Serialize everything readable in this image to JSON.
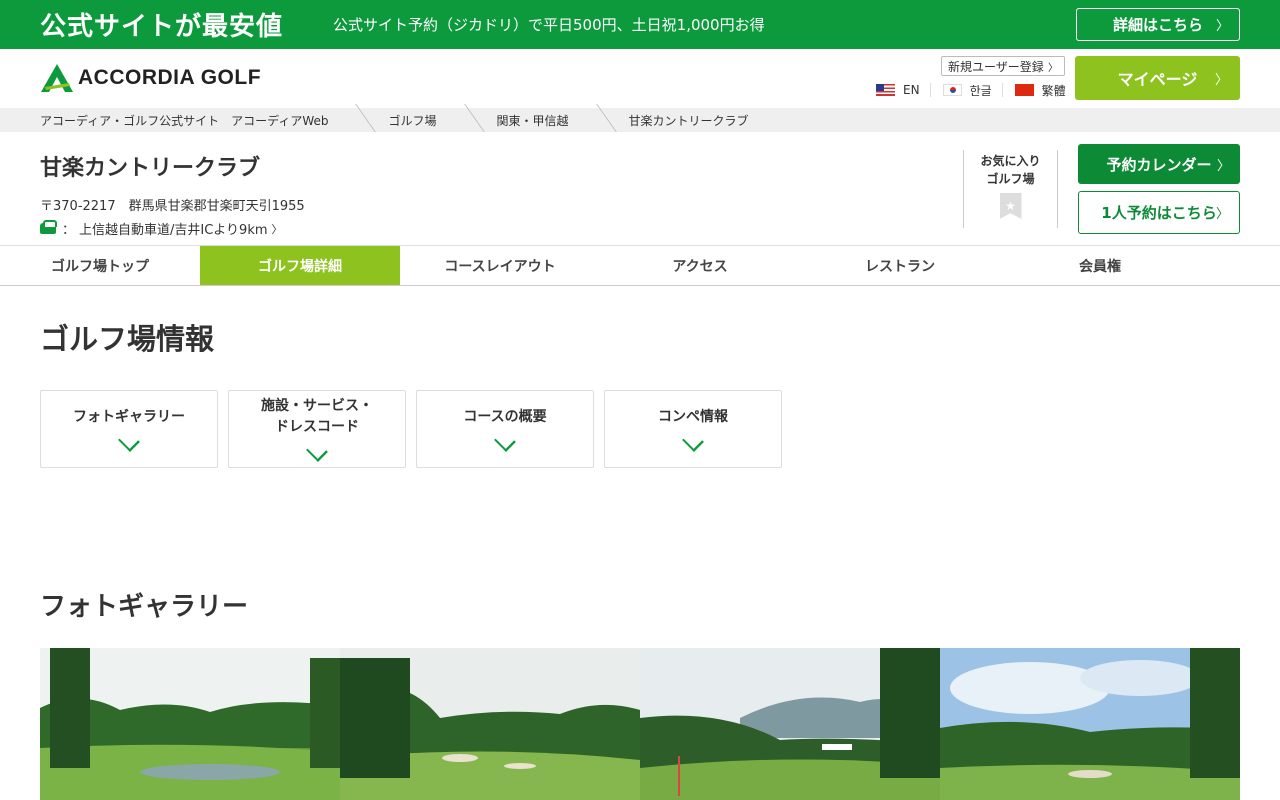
{
  "promo": {
    "headline": "公式サイトが最安値",
    "subtext": "公式サイト予約（ジカドリ）で平日500円、土日祝1,000円お得",
    "detail_button": "詳細はこちら"
  },
  "header": {
    "logo_text": "ACCORDIA GOLF",
    "register_link": "新規ユーザー登録",
    "languages": [
      {
        "label": "EN",
        "flag": "us-flag-icon"
      },
      {
        "label": "한글",
        "flag": "kr-flag-icon"
      },
      {
        "label": "繁體",
        "flag": "cn-flag-icon"
      }
    ],
    "mypage_button": "マイページ"
  },
  "breadcrumb": [
    "アコーディア・ゴルフ公式サイト　アコーディアWeb",
    "ゴルフ場",
    "関東・甲信越",
    "甘楽カントリークラブ"
  ],
  "course": {
    "name": "甘楽カントリークラブ",
    "address": "〒370-2217　群馬県甘楽郡甘楽町天引1955",
    "access_prefix": "：",
    "access": "上信越自動車道/吉井ICより9km",
    "favorite_line1": "お気に入り",
    "favorite_line2": "ゴルフ場",
    "calendar_button": "予約カレンダー",
    "solo_button": "1人予約はこちら"
  },
  "tabs": [
    {
      "label": "ゴルフ場トップ",
      "active": false
    },
    {
      "label": "ゴルフ場詳細",
      "active": true
    },
    {
      "label": "コースレイアウト",
      "active": false
    },
    {
      "label": "アクセス",
      "active": false
    },
    {
      "label": "レストラン",
      "active": false
    },
    {
      "label": "会員権",
      "active": false
    }
  ],
  "info": {
    "title": "ゴルフ場情報",
    "cards": [
      {
        "line1": "フォトギャラリー",
        "line2": ""
      },
      {
        "line1": "施設・サービス・",
        "line2": "ドレスコード"
      },
      {
        "line1": "コースの概要",
        "line2": ""
      },
      {
        "line1": "コンペ情報",
        "line2": ""
      }
    ]
  },
  "gallery": {
    "title": "フォトギャラリー"
  },
  "colors": {
    "brand_green": "#0c9a3d",
    "accent_lime": "#8dc21f"
  }
}
